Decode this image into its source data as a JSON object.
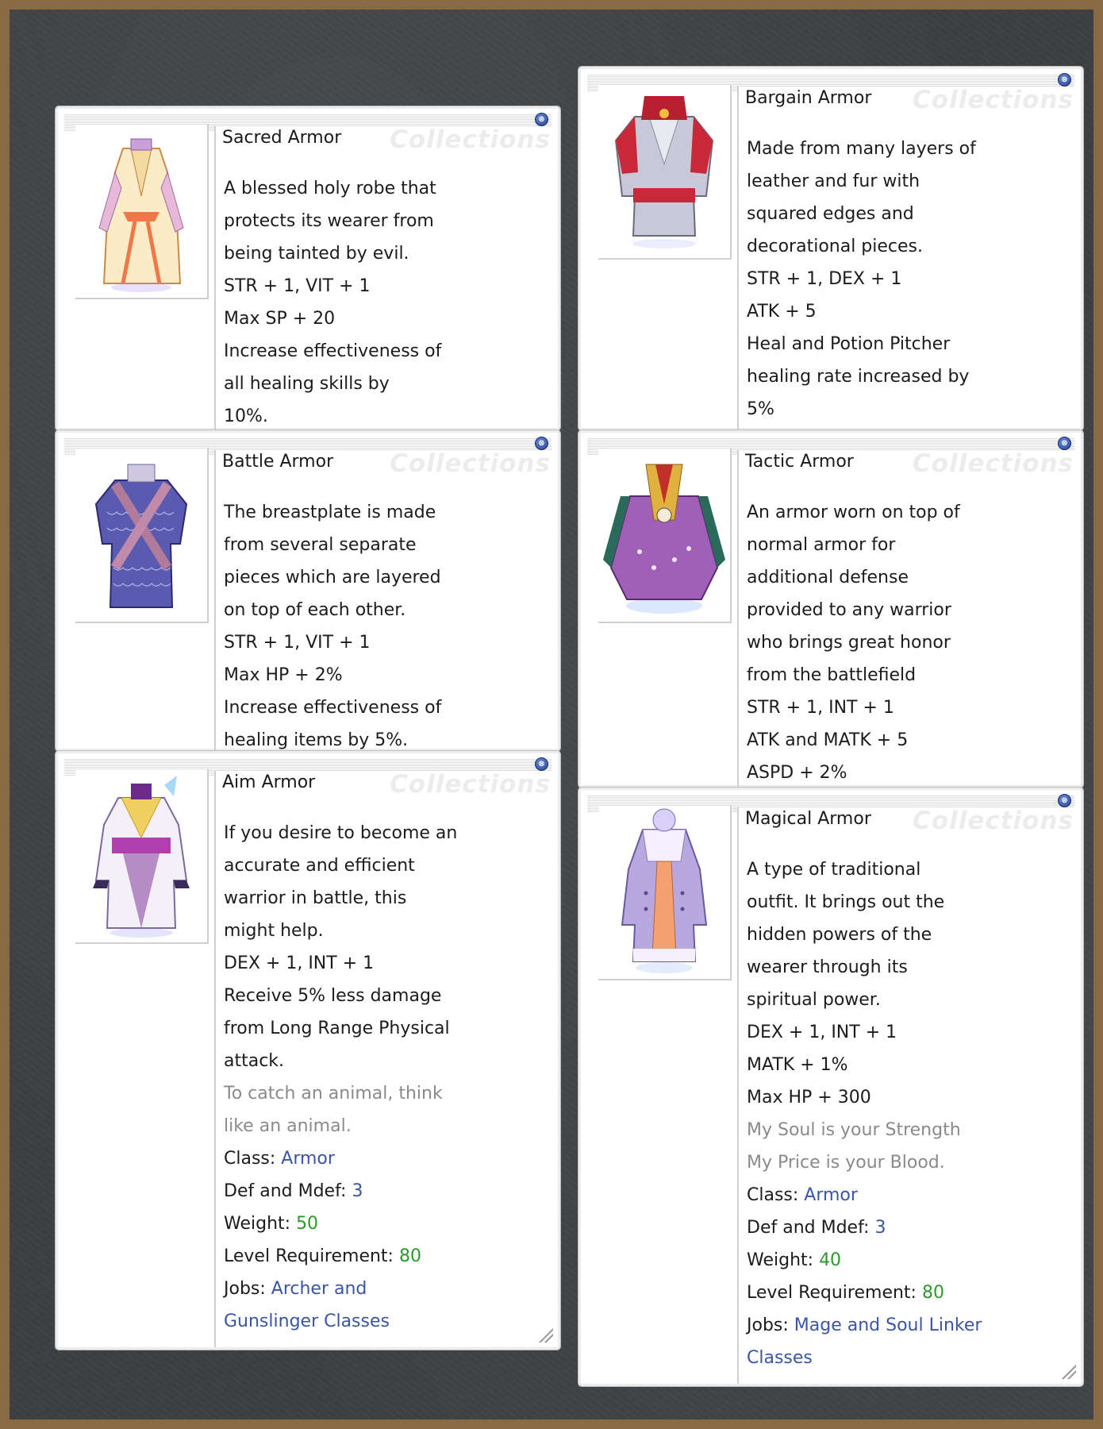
{
  "watermark": "Collections",
  "close_glyph": "⊗",
  "left_column": [
    {
      "title": "Sacred Armor",
      "lines": [
        "A blessed holy robe that",
        "protects its wearer from",
        "being tainted by evil.",
        "STR + 1, VIT + 1",
        "Max SP + 20",
        "Increase effectiveness of",
        "all healing skills by",
        "10%."
      ],
      "image_icon": "sacred-armor-icon"
    },
    {
      "title": "Battle Armor",
      "lines": [
        "The breastplate is made",
        "from several separate",
        "pieces which are layered",
        "on top of each other.",
        "STR + 1, VIT + 1",
        "Max HP + 2%",
        "Increase effectiveness of",
        "healing items by 5%."
      ],
      "image_icon": "battle-armor-icon"
    },
    {
      "title": "Aim Armor",
      "lines": [
        "If you desire to become an",
        "accurate and efficient",
        "warrior in battle, this",
        "might help.",
        "DEX + 1, INT + 1",
        "Receive 5% less damage",
        "from Long Range Physical",
        "attack."
      ],
      "quote": [
        "To catch an animal, think",
        "like an animal."
      ],
      "details": {
        "class_label": "Class: ",
        "class_value": "Armor",
        "def_label": "Def and Mdef: ",
        "def_value": "3",
        "weight_label": "Weight: ",
        "weight_value": "50",
        "level_label": "Level Requirement: ",
        "level_value": "80",
        "jobs_label": "Jobs: ",
        "jobs_value_1": "Archer and",
        "jobs_value_2": "Gunslinger Classes"
      },
      "image_icon": "aim-armor-icon"
    }
  ],
  "right_column": [
    {
      "title": "Bargain Armor",
      "lines": [
        "Made from many layers of",
        "leather and fur with",
        "squared edges and",
        "decorational pieces.",
        "STR + 1, DEX + 1",
        "ATK + 5",
        "Heal and Potion Pitcher",
        "healing rate increased by",
        "5%"
      ],
      "image_icon": "bargain-armor-icon"
    },
    {
      "title": "Tactic Armor",
      "lines": [
        "An armor worn on top of",
        "normal armor for",
        "additional defense",
        "provided to any warrior",
        "who brings great honor",
        "from the battlefield",
        "STR + 1, INT + 1",
        "ATK and MATK + 5",
        "ASPD + 2%"
      ],
      "image_icon": "tactic-armor-icon"
    },
    {
      "title": "Magical Armor",
      "lines": [
        "A type of traditional",
        "outfit. It brings out the",
        "hidden powers of the",
        "wearer through its",
        "spiritual power.",
        "DEX + 1, INT + 1",
        "MATK + 1%",
        "Max HP + 300"
      ],
      "quote": [
        "My Soul is your Strength",
        "My Price is your Blood."
      ],
      "details": {
        "class_label": "Class: ",
        "class_value": "Armor",
        "def_label": "Def and Mdef: ",
        "def_value": "3",
        "weight_label": "Weight: ",
        "weight_value": "40",
        "level_label": "Level Requirement: ",
        "level_value": "80",
        "jobs_label": "Jobs: ",
        "jobs_value_1": "Mage and Soul Linker",
        "jobs_value_2": "Classes"
      },
      "image_icon": "magical-armor-icon"
    }
  ],
  "colors": {
    "background": "#3c4043",
    "frame": "#8a6a42",
    "link_blue": "#3a55a8",
    "value_green": "#2b9a2b",
    "quote_gray": "#8a8a8a"
  }
}
